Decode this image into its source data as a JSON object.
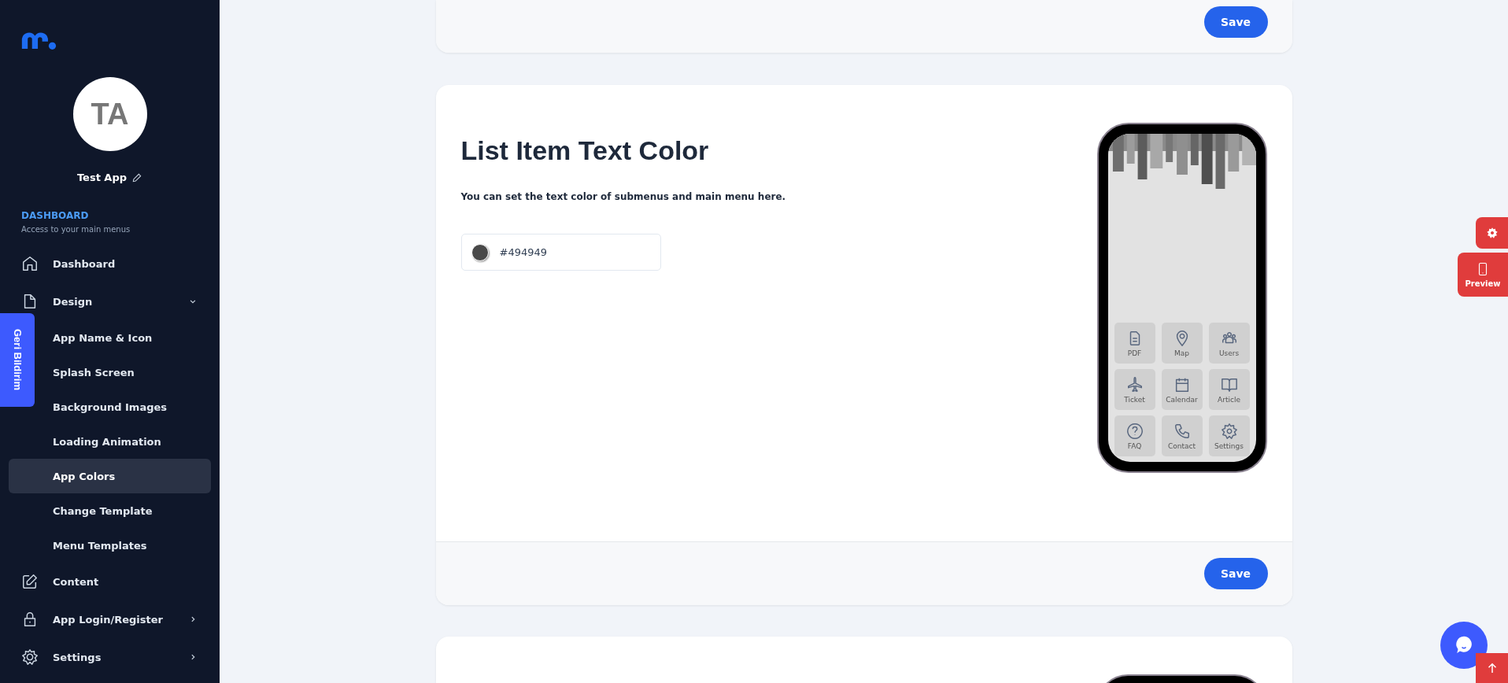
{
  "sidebar": {
    "avatar_initials": "TA",
    "app_name": "Test App",
    "section_title": "DASHBOARD",
    "section_subtitle": "Access to your main menus",
    "items": [
      {
        "label": "Dashboard",
        "kind": "home",
        "selected": false
      },
      {
        "label": "Design",
        "kind": "design",
        "selected": false,
        "expanded": true,
        "children": [
          {
            "label": "App Name & Icon",
            "selected": false
          },
          {
            "label": "Splash Screen",
            "selected": false
          },
          {
            "label": "Background Images",
            "selected": false
          },
          {
            "label": "Loading Animation",
            "selected": false
          },
          {
            "label": "App Colors",
            "selected": true
          },
          {
            "label": "Change Template",
            "selected": false
          },
          {
            "label": "Menu Templates",
            "selected": false
          }
        ]
      },
      {
        "label": "Content",
        "kind": "edit",
        "selected": false
      },
      {
        "label": "App Login/Register",
        "kind": "lock",
        "selected": false,
        "expanded": false
      },
      {
        "label": "Settings",
        "kind": "settings",
        "selected": false,
        "expanded": false
      }
    ]
  },
  "feedback_tab": "Geri Bildirim",
  "top_card": {
    "save_button": "Save"
  },
  "card": {
    "title": "List Item Text Color",
    "description": "You can set the text color of submenus and main menu here.",
    "color_field": {
      "value": "#494949"
    },
    "save_button": "Save",
    "phone_tiles": [
      {
        "label": "PDF",
        "kind": "document"
      },
      {
        "label": "Map",
        "kind": "pin"
      },
      {
        "label": "Users",
        "kind": "users"
      },
      {
        "label": "Ticket",
        "kind": "plane"
      },
      {
        "label": "Calendar",
        "kind": "calendar"
      },
      {
        "label": "Article",
        "kind": "book"
      },
      {
        "label": "FAQ",
        "kind": "question"
      },
      {
        "label": "Contact",
        "kind": "phone"
      },
      {
        "label": "Settings",
        "kind": "gear"
      }
    ]
  },
  "preview_button": "Preview"
}
